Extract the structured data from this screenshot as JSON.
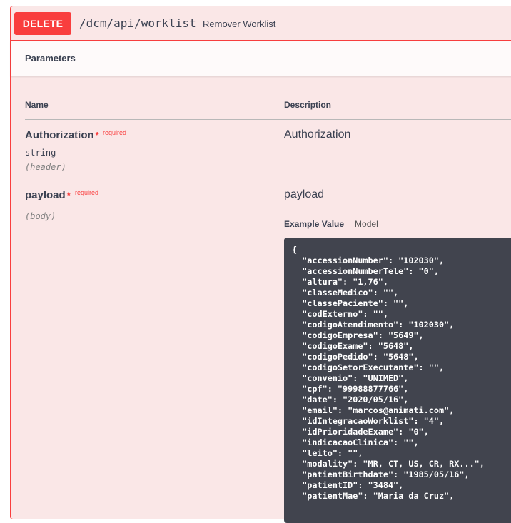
{
  "operation": {
    "method": "DELETE",
    "path": "/dcm/api/worklist",
    "summary": "Remover Worklist"
  },
  "parameters": {
    "title": "Parameters",
    "col_name": "Name",
    "col_description": "Description",
    "items": [
      {
        "name": "Authorization",
        "star": "*",
        "required": "required",
        "type": "string",
        "in": "(header)",
        "description": "Authorization"
      },
      {
        "name": "payload",
        "star": "*",
        "required": "required",
        "in": "(body)",
        "description": "payload"
      }
    ]
  },
  "example": {
    "tab_example": "Example Value",
    "tab_model": "Model",
    "lines": [
      "{",
      "  \"accessionNumber\": \"102030\",",
      "  \"accessionNumberTele\": \"0\",",
      "  \"altura\": \"1,76\",",
      "  \"classeMedico\": \"\",",
      "  \"classePaciente\": \"\",",
      "  \"codExterno\": \"\",",
      "  \"codigoAtendimento\": \"102030\",",
      "  \"codigoEmpresa\": \"5649\",",
      "  \"codigoExame\": \"5648\",",
      "  \"codigoPedido\": \"5648\",",
      "  \"codigoSetorExecutante\": \"\",",
      "  \"convenio\": \"UNIMED\",",
      "  \"cpf\": \"99988877766\",",
      "  \"date\": \"2020/05/16\",",
      "  \"email\": \"marcos@animati.com\",",
      "  \"idIntegracaoWorklist\": \"4\",",
      "  \"idPrioridadeExame\": \"0\",",
      "  \"indicacaoClinica\": \"\",",
      "  \"leito\": \"\",",
      "  \"modality\": \"MR, CT, US, CR, RX...\",",
      "  \"patientBirthdate\": \"1985/05/16\",",
      "  \"patientID\": \"3484\",",
      "  \"patientMae\": \"Maria da Cruz\","
    ]
  }
}
